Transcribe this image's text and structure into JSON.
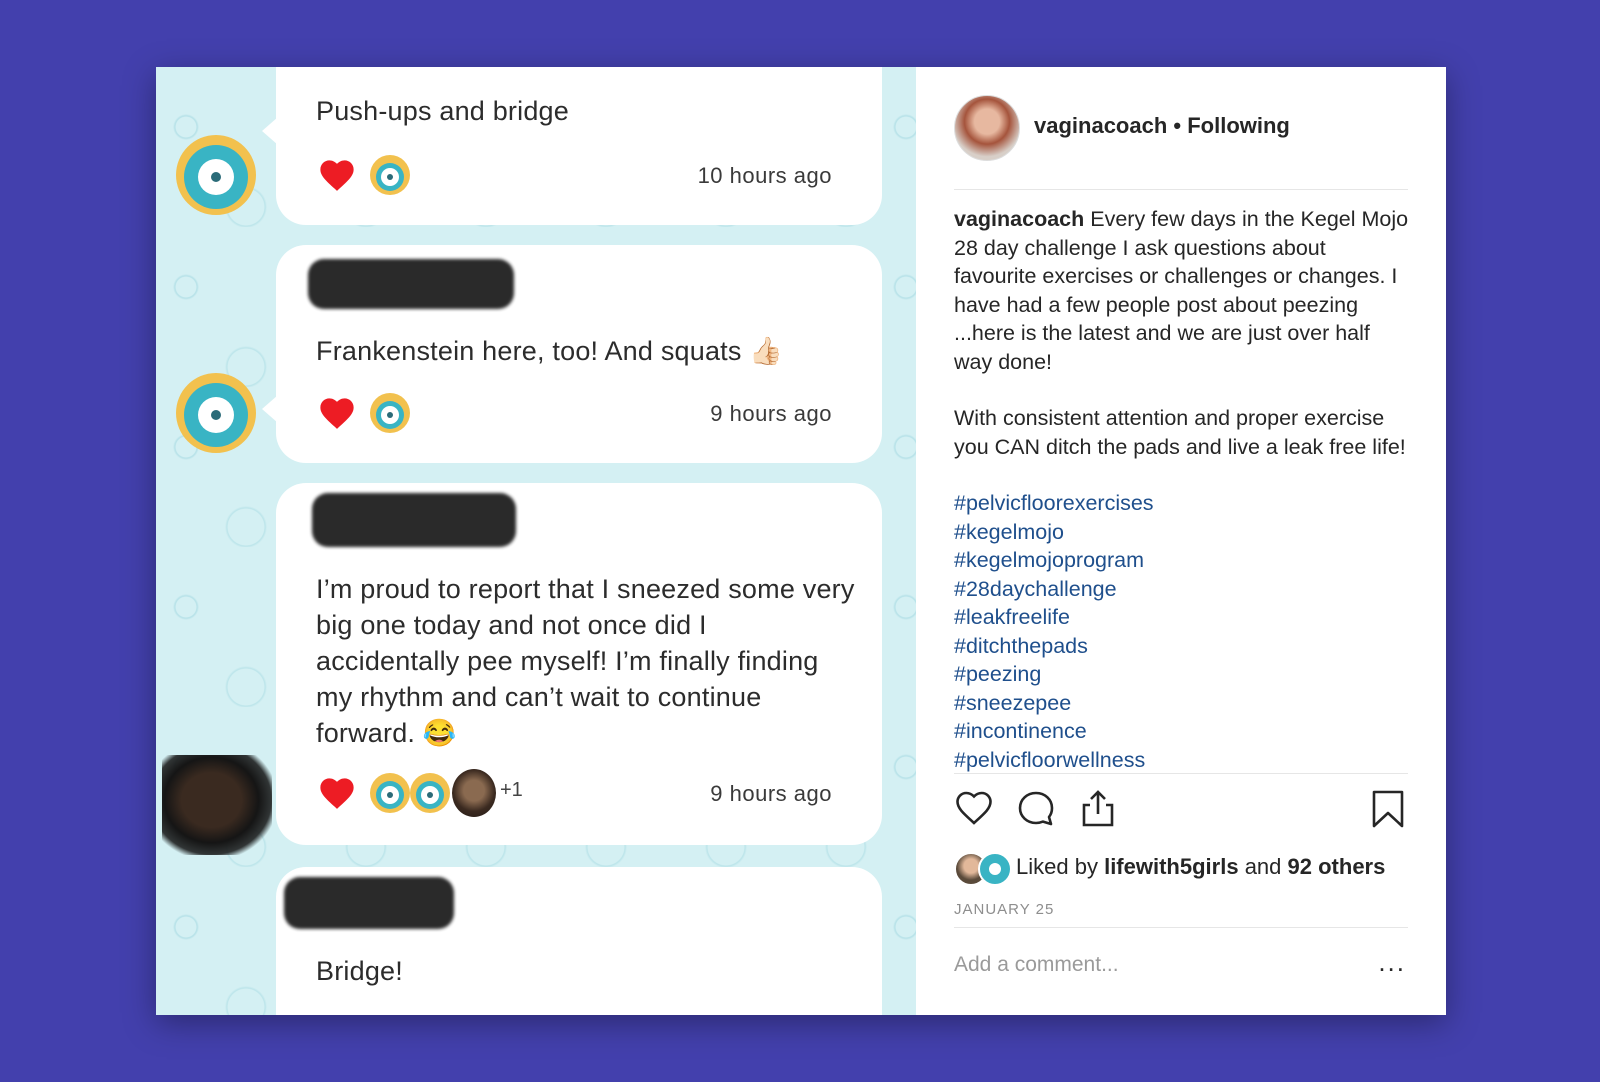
{
  "chat": {
    "messages": [
      {
        "text": "Push-ups and bridge",
        "time": "10 hours ago",
        "reactions": [
          "heart-icon",
          "app-avatar"
        ]
      },
      {
        "text": "Frankenstein here, too! And squats 👍🏻",
        "time": "9 hours ago",
        "reactions": [
          "heart-icon",
          "app-avatar"
        ]
      },
      {
        "text": "I’m proud to report that I sneezed some very big one today and not once did I accidentally pee myself! I’m finally finding my rhythm and can’t wait to continue forward. 😂",
        "time": "9 hours ago",
        "extra_count": "+1",
        "reactions": [
          "heart-icon",
          "app-avatar",
          "app-avatar",
          "photo-avatar"
        ]
      },
      {
        "text": "Bridge!"
      }
    ]
  },
  "post": {
    "username": "vaginacoach",
    "follow_status": "• Following",
    "caption_user": "vaginacoach",
    "caption_p1": "Every few days in the Kegel Mojo 28 day challenge I ask questions about favourite exercises or challenges or changes. I have had a few people post about peezing ...here is the latest and we are just over half way done!",
    "caption_p2": "With consistent attention and proper exercise you CAN ditch the pads and live a leak free life!",
    "hashtags": [
      "#pelvicfloorexercises",
      "#kegelmojo",
      "#kegelmojoprogram",
      "#28daychallenge",
      "#leakfreelife",
      "#ditchthepads",
      "#peezing",
      "#sneezepee",
      "#incontinence",
      "#pelvicfloorwellness"
    ],
    "liked_prefix": "Liked by",
    "liked_user": "lifewith5girls",
    "liked_and": "and",
    "liked_others": "92 others",
    "date": "JANUARY 25",
    "comment_placeholder": "Add a comment...",
    "more_label": "..."
  },
  "colors": {
    "background": "#4340ad",
    "chat_bg": "#d4f0f3",
    "hashtag": "#1f4f8c",
    "heart": "#ed1c24"
  }
}
